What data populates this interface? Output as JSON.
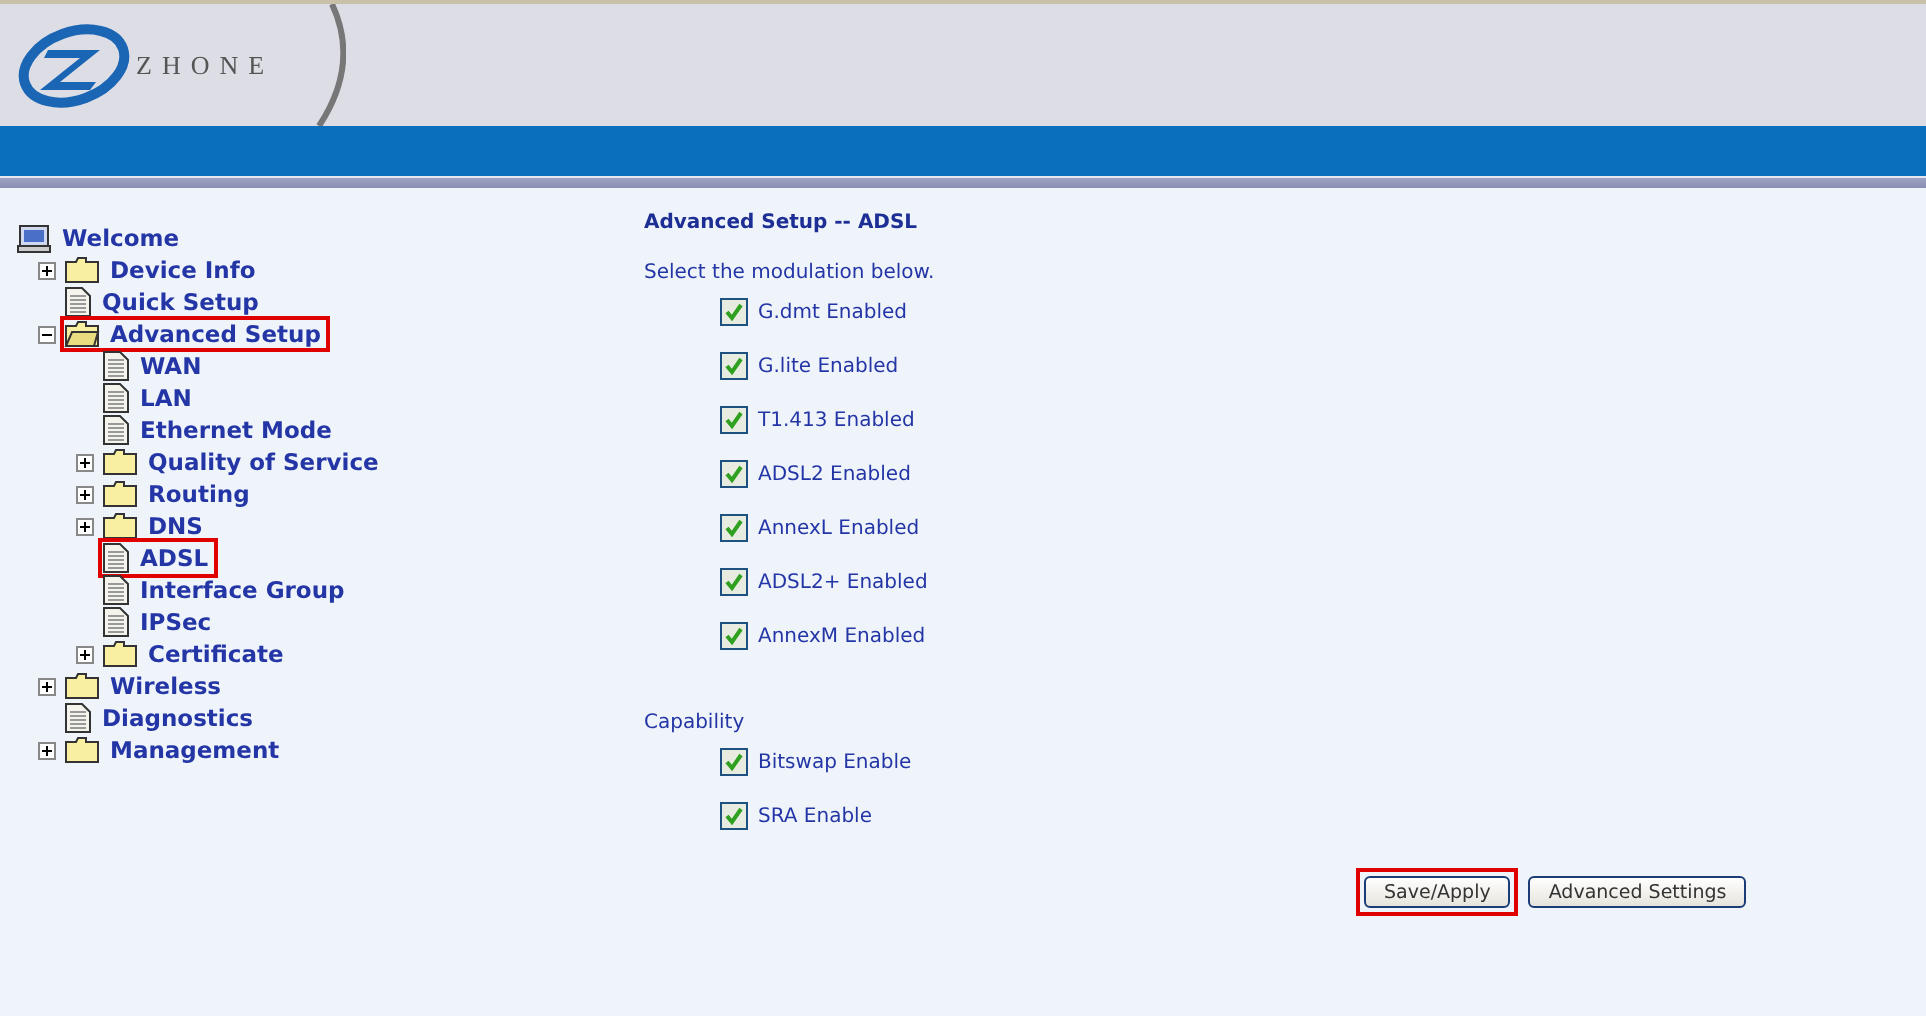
{
  "header": {
    "logo": "ZHONE"
  },
  "tree": {
    "root": {
      "label": "Welcome"
    },
    "items": [
      {
        "label": "Device Info",
        "kind": "folder",
        "expanded": false,
        "highlighted": false
      },
      {
        "label": "Quick Setup",
        "kind": "page",
        "highlighted": false
      },
      {
        "label": "Advanced Setup",
        "kind": "folder",
        "expanded": true,
        "highlighted": true,
        "children": [
          {
            "label": "WAN",
            "kind": "page",
            "highlighted": false
          },
          {
            "label": "LAN",
            "kind": "page",
            "highlighted": false
          },
          {
            "label": "Ethernet Mode",
            "kind": "page",
            "highlighted": false
          },
          {
            "label": "Quality of Service",
            "kind": "folder",
            "expanded": false,
            "highlighted": false
          },
          {
            "label": "Routing",
            "kind": "folder",
            "expanded": false,
            "highlighted": false
          },
          {
            "label": "DNS",
            "kind": "folder",
            "expanded": false,
            "highlighted": false
          },
          {
            "label": "ADSL",
            "kind": "page",
            "highlighted": true
          },
          {
            "label": "Interface Group",
            "kind": "page",
            "highlighted": false
          },
          {
            "label": "IPSec",
            "kind": "page",
            "highlighted": false
          },
          {
            "label": "Certificate",
            "kind": "folder",
            "expanded": false,
            "highlighted": false
          }
        ]
      },
      {
        "label": "Wireless",
        "kind": "folder",
        "expanded": false,
        "highlighted": false
      },
      {
        "label": "Diagnostics",
        "kind": "page",
        "highlighted": false
      },
      {
        "label": "Management",
        "kind": "folder",
        "expanded": false,
        "highlighted": false
      }
    ]
  },
  "content": {
    "title": "Advanced Setup -- ADSL",
    "intro": "Select the modulation below.",
    "modulations": [
      {
        "label": "G.dmt Enabled",
        "checked": true
      },
      {
        "label": "G.lite Enabled",
        "checked": true
      },
      {
        "label": "T1.413 Enabled",
        "checked": true
      },
      {
        "label": "ADSL2 Enabled",
        "checked": true
      },
      {
        "label": "AnnexL Enabled",
        "checked": true
      },
      {
        "label": "ADSL2+ Enabled",
        "checked": true
      },
      {
        "label": "AnnexM Enabled",
        "checked": true
      }
    ],
    "capability_title": "Capability",
    "capabilities": [
      {
        "label": "Bitswap Enable",
        "checked": true
      },
      {
        "label": "SRA Enable",
        "checked": true
      }
    ],
    "buttons": [
      {
        "label": "Save/Apply",
        "highlighted": true
      },
      {
        "label": "Advanced Settings",
        "highlighted": false
      }
    ]
  }
}
